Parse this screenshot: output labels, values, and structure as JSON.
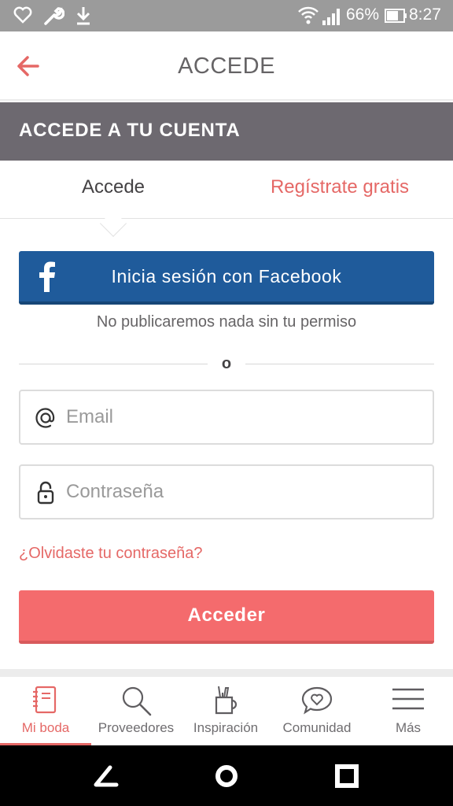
{
  "status_bar": {
    "battery_percent": "66%",
    "time": "8:27",
    "icons": [
      "heart-outline-icon",
      "wrench-icon",
      "download-icon",
      "wifi-icon",
      "signal-icon",
      "battery-icon"
    ]
  },
  "header": {
    "title": "ACCEDE",
    "back_icon": "arrow-left-icon"
  },
  "section": {
    "title": "ACCEDE A TU CUENTA"
  },
  "tabs": [
    {
      "label": "Accede",
      "active": true
    },
    {
      "label": "Regístrate gratis",
      "active": false
    }
  ],
  "facebook": {
    "button_label": "Inicia sesión con Facebook",
    "note": "No publicaremos nada sin tu permiso",
    "icon": "facebook-icon"
  },
  "divider": {
    "text": "o"
  },
  "form": {
    "email_placeholder": "Email",
    "email_value": "",
    "password_placeholder": "Contraseña",
    "password_value": "",
    "forgot_link": "¿Olvidaste tu contraseña?",
    "submit_label": "Acceder"
  },
  "bottom_nav": {
    "items": [
      {
        "label": "Mi boda",
        "icon": "notebook-icon",
        "active": true
      },
      {
        "label": "Proveedores",
        "icon": "search-icon",
        "active": false
      },
      {
        "label": "Inspiración",
        "icon": "pencil-cup-icon",
        "active": false
      },
      {
        "label": "Comunidad",
        "icon": "heart-chat-icon",
        "active": false
      },
      {
        "label": "Más",
        "icon": "menu-icon",
        "active": false
      }
    ]
  },
  "colors": {
    "accent": "#f46b6d",
    "accent_text": "#e56866",
    "facebook": "#1f5b9b",
    "section_band": "#6d6970",
    "status_bar": "#9b9b9b"
  }
}
